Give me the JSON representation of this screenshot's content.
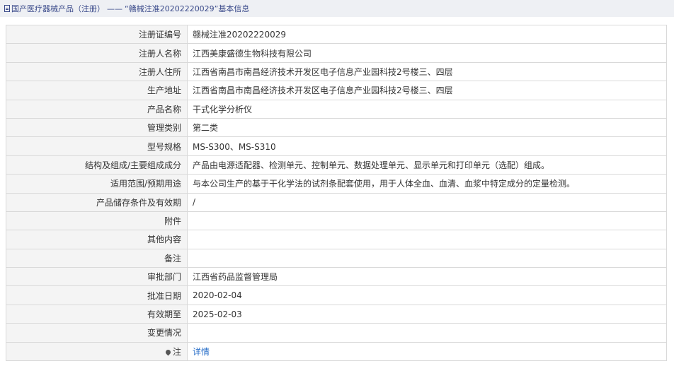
{
  "breadcrumb": {
    "category": "国产医疗器械产品（注册）",
    "separator": "——",
    "current": "“赣械注准20202220029”基本信息"
  },
  "rows": [
    {
      "label": "注册证编号",
      "value": "赣械注准20202220029"
    },
    {
      "label": "注册人名称",
      "value": "江西美康盛德生物科技有限公司"
    },
    {
      "label": "注册人住所",
      "value": "江西省南昌市南昌经济技术开发区电子信息产业园科技2号楼三、四层"
    },
    {
      "label": "生产地址",
      "value": "江西省南昌市南昌经济技术开发区电子信息产业园科技2号楼三、四层"
    },
    {
      "label": "产品名称",
      "value": "干式化学分析仪"
    },
    {
      "label": "管理类别",
      "value": "第二类"
    },
    {
      "label": "型号规格",
      "value": "MS-S300、MS-S310"
    },
    {
      "label": "结构及组成/主要组成成分",
      "value": "产品由电源适配器、检测单元、控制单元、数据处理单元、显示单元和打印单元（选配）组成。"
    },
    {
      "label": "适用范围/预期用途",
      "value": "与本公司生产的基于干化学法的试剂条配套使用，用于人体全血、血清、血浆中特定成分的定量检测。"
    },
    {
      "label": "产品储存条件及有效期",
      "value": "/"
    },
    {
      "label": "附件",
      "value": ""
    },
    {
      "label": "其他内容",
      "value": ""
    },
    {
      "label": "备注",
      "value": ""
    },
    {
      "label": "审批部门",
      "value": "江西省药品监督管理局"
    },
    {
      "label": "批准日期",
      "value": "2020-02-04"
    },
    {
      "label": "有效期至",
      "value": "2025-02-03"
    },
    {
      "label": "变更情况",
      "value": ""
    }
  ],
  "note": {
    "label": "注",
    "link_text": "详情",
    "icon": "pin-icon"
  },
  "colors": {
    "link": "#2a6fc9",
    "label_bg": "#f4f4f4",
    "border": "#d9d9d9",
    "header_bg": "#eef0f4"
  }
}
